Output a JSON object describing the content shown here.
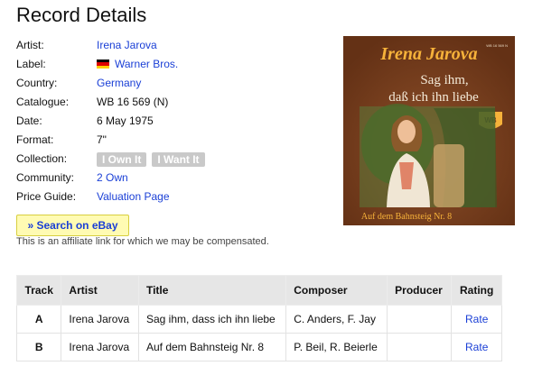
{
  "page": {
    "title": "Record Details"
  },
  "details": [
    {
      "label": "Artist:",
      "value": "Irena Jarova",
      "link": true
    },
    {
      "label": "Label:",
      "value": "Warner Bros.",
      "link": true,
      "flag": "germany"
    },
    {
      "label": "Country:",
      "value": "Germany",
      "link": true
    },
    {
      "label": "Catalogue:",
      "value": "WB 16 569 (N)",
      "link": false
    },
    {
      "label": "Date:",
      "value": "6 May 1975",
      "link": false
    },
    {
      "label": "Format:",
      "value": "7\"",
      "link": false
    },
    {
      "label": "Collection:",
      "buttons": [
        "I Own It",
        "I Want It"
      ]
    },
    {
      "label": "Community:",
      "value": "2 Own",
      "link": true
    },
    {
      "label": "Price Guide:",
      "value": "Valuation Page",
      "link": true
    }
  ],
  "ebay": {
    "button_label": "» Search on eBay",
    "note": "This is an affiliate link for which we may be compensated."
  },
  "cover": {
    "artist": "Irena Jarova",
    "title_line1": "Sag ihm,",
    "title_line2": "daß ich ihn liebe",
    "bottom_text": "Auf dem Bahnsteig Nr. 8",
    "catalogue_small": "WB 16 569 N"
  },
  "tracks": {
    "headers": [
      "Track",
      "Artist",
      "Title",
      "Composer",
      "Producer",
      "Rating"
    ],
    "rows": [
      {
        "track": "A",
        "artist": "Irena Jarova",
        "title": "Sag ihm, dass ich ihn liebe",
        "composer": "C. Anders, F. Jay",
        "producer": "",
        "rating": "Rate"
      },
      {
        "track": "B",
        "artist": "Irena Jarova",
        "title": "Auf dem Bahnsteig Nr. 8",
        "composer": "P. Beil, R. Beierle",
        "producer": "",
        "rating": "Rate"
      }
    ]
  },
  "colors": {
    "link": "#1a3fd6",
    "cover_bg": "#7a3d1c",
    "cover_text": "#f6b23a",
    "ebay_bg": "#fffbb3"
  },
  "flag_colors": {
    "germany": [
      "#000000",
      "#dd0000",
      "#ffce00"
    ]
  }
}
